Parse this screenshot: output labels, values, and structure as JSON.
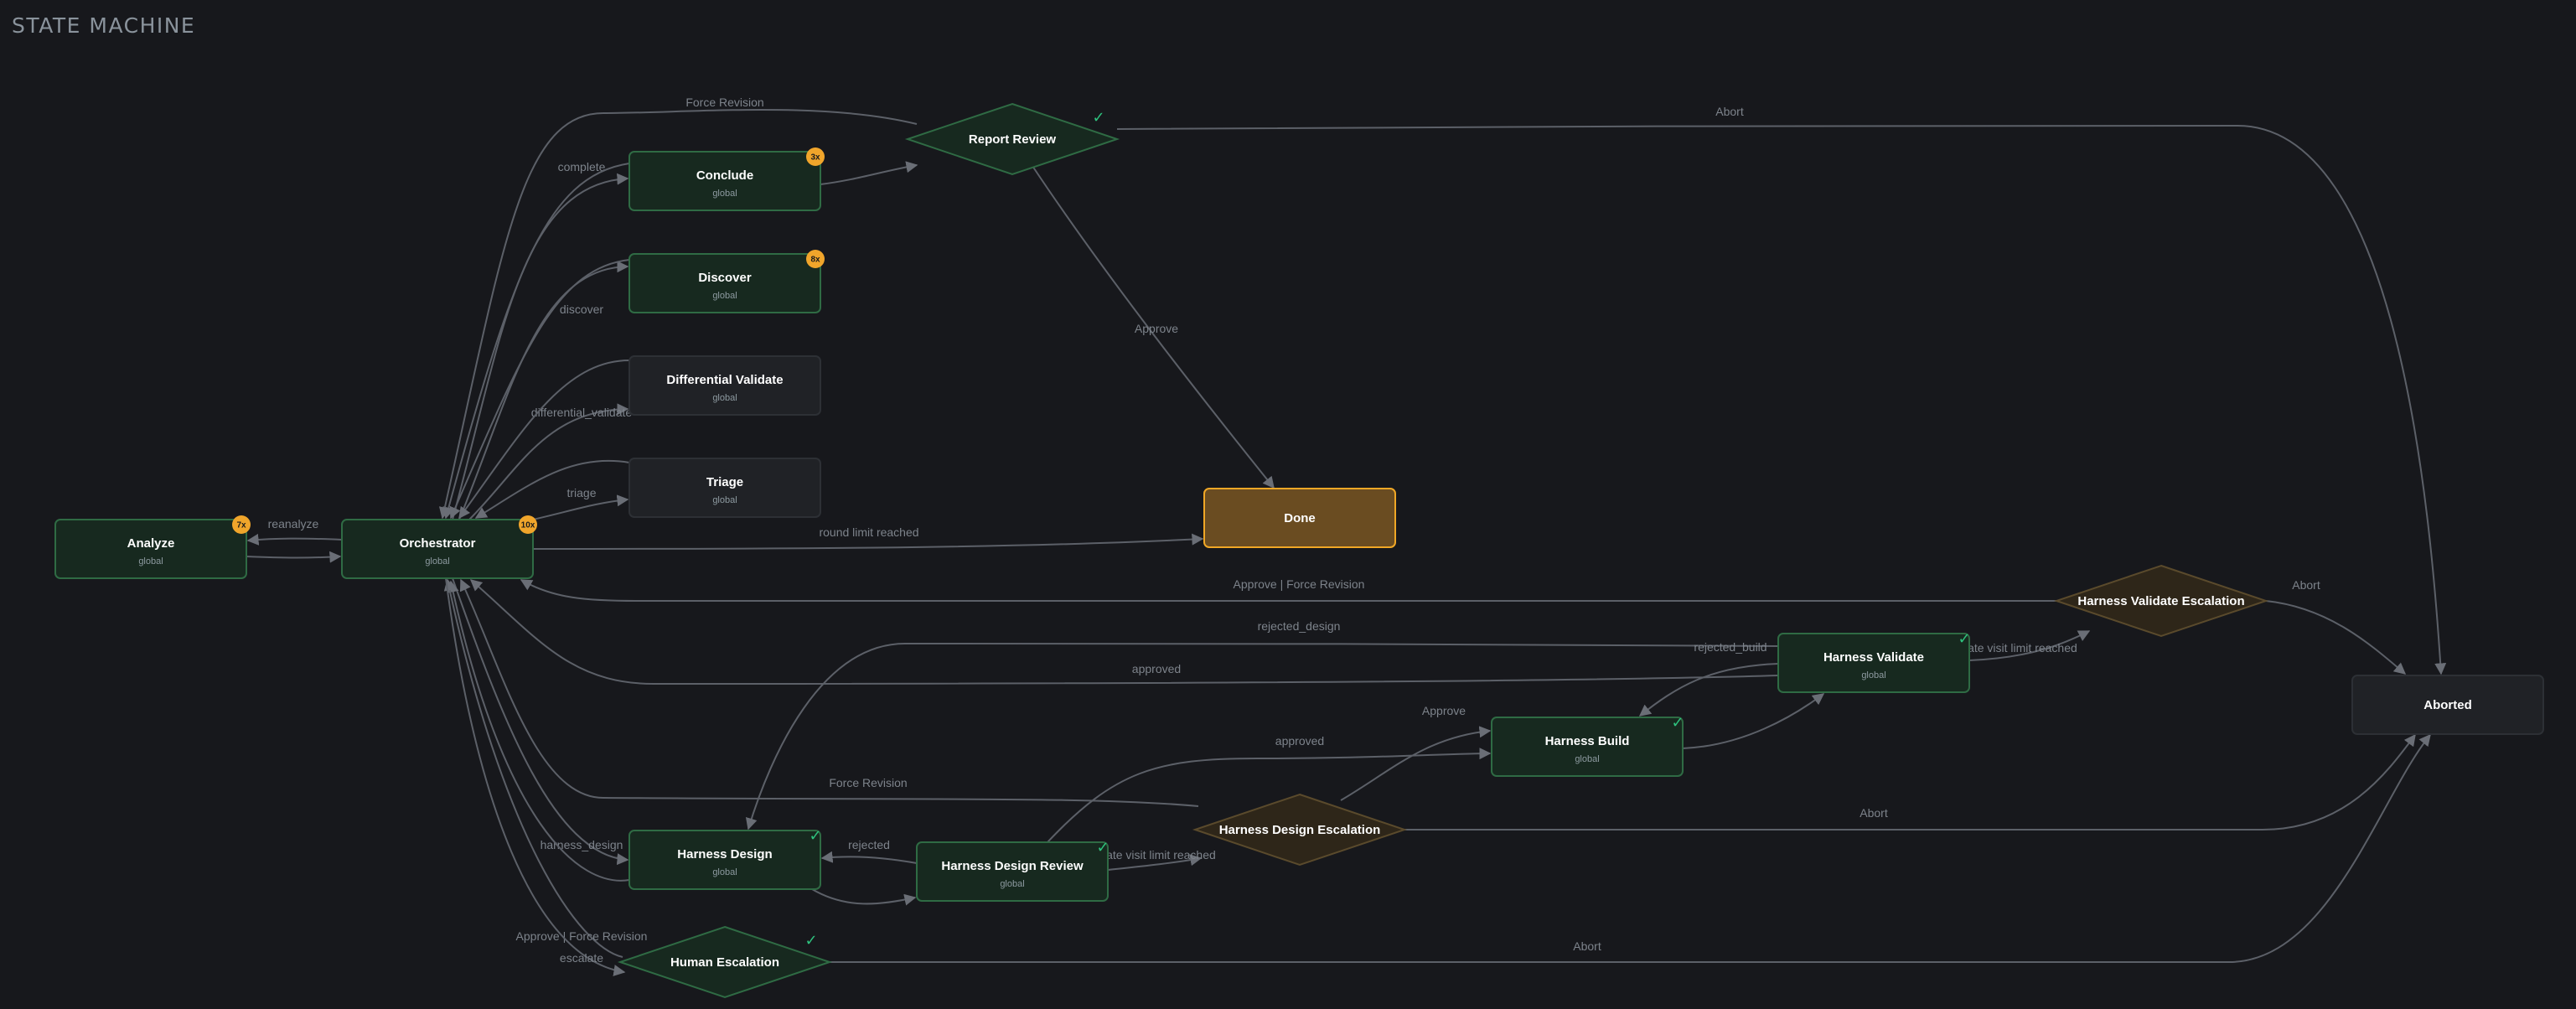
{
  "page": {
    "title": "STATE MACHINE"
  },
  "colors": {
    "background": "#17181c",
    "edge": "#5c6068",
    "edge_label": "#7d838b",
    "active_fill": "#17291f",
    "active_stroke": "#2f6b44",
    "idle_fill": "#202226",
    "idle_stroke": "#2d3035",
    "escalation_fill": "#2e2619",
    "escalation_stroke": "#5a4a2c",
    "done_fill": "#6a4c21",
    "done_stroke": "#f0a726",
    "badge": "#f0a52b",
    "check": "#2ec27e"
  },
  "nodes": [
    {
      "id": "analyze",
      "label": "Analyze",
      "sub": "global",
      "kind": "active",
      "badge": "7x"
    },
    {
      "id": "orchestrator",
      "label": "Orchestrator",
      "sub": "global",
      "kind": "active",
      "badge": "10x"
    },
    {
      "id": "conclude",
      "label": "Conclude",
      "sub": "global",
      "kind": "active",
      "badge": "3x"
    },
    {
      "id": "discover",
      "label": "Discover",
      "sub": "global",
      "kind": "active",
      "badge": "8x"
    },
    {
      "id": "differential-validate",
      "label": "Differential Validate",
      "sub": "global",
      "kind": "idle"
    },
    {
      "id": "triage",
      "label": "Triage",
      "sub": "global",
      "kind": "idle"
    },
    {
      "id": "report-review",
      "label": "Report Review",
      "kind": "decision-active",
      "check": true
    },
    {
      "id": "done",
      "label": "Done",
      "kind": "done"
    },
    {
      "id": "harness-validate-escalation",
      "label": "Harness Validate Escalation",
      "kind": "decision-escalation"
    },
    {
      "id": "harness-validate",
      "label": "Harness Validate",
      "sub": "global",
      "kind": "active",
      "check": true
    },
    {
      "id": "harness-build",
      "label": "Harness Build",
      "sub": "global",
      "kind": "active",
      "check": true
    },
    {
      "id": "aborted",
      "label": "Aborted",
      "kind": "idle"
    },
    {
      "id": "harness-design-escalation",
      "label": "Harness Design Escalation",
      "kind": "decision-escalation"
    },
    {
      "id": "harness-design",
      "label": "Harness Design",
      "sub": "global",
      "kind": "active",
      "check": true
    },
    {
      "id": "harness-design-review",
      "label": "Harness Design Review",
      "sub": "global",
      "kind": "active",
      "check": true
    },
    {
      "id": "human-escalation",
      "label": "Human Escalation",
      "kind": "decision-active",
      "check": true
    }
  ],
  "edges": [
    {
      "id": "analyze-to-orchestrator",
      "label": ""
    },
    {
      "id": "orchestrator-to-analyze",
      "label": "reanalyze"
    },
    {
      "id": "orchestrator-to-conclude",
      "label": "complete"
    },
    {
      "id": "orchestrator-to-discover",
      "label": "discover"
    },
    {
      "id": "orchestrator-to-differential-validate",
      "label": "differential_validate"
    },
    {
      "id": "orchestrator-to-triage",
      "label": "triage"
    },
    {
      "id": "conclude-to-orchestrator",
      "label": ""
    },
    {
      "id": "discover-to-orchestrator",
      "label": ""
    },
    {
      "id": "differential-validate-to-orchestrator",
      "label": ""
    },
    {
      "id": "triage-to-orchestrator",
      "label": ""
    },
    {
      "id": "conclude-to-report-review",
      "label": ""
    },
    {
      "id": "report-review-to-orchestrator",
      "label": "Force Revision"
    },
    {
      "id": "report-review-to-aborted",
      "label": "Abort"
    },
    {
      "id": "report-review-to-done",
      "label": "Approve"
    },
    {
      "id": "orchestrator-to-done",
      "label": "round limit reached"
    },
    {
      "id": "harness-validate-escalation-to-orchestrator",
      "label": "Approve | Force Revision"
    },
    {
      "id": "harness-validate-escalation-to-aborted",
      "label": "Abort"
    },
    {
      "id": "harness-validate-to-harness-design",
      "label": "rejected_design"
    },
    {
      "id": "harness-validate-to-orchestrator",
      "label": "approved"
    },
    {
      "id": "harness-validate-to-harness-build",
      "label": "rejected_build"
    },
    {
      "id": "harness-validate-to-harness-validate-escalation",
      "label": "state visit limit reached"
    },
    {
      "id": "harness-build-to-harness-validate",
      "label": ""
    },
    {
      "id": "harness-design-escalation-to-harness-build",
      "label": "Approve"
    },
    {
      "id": "harness-design-review-to-harness-build",
      "label": "approved"
    },
    {
      "id": "harness-design-escalation-to-orchestrator",
      "label": "Force Revision"
    },
    {
      "id": "harness-design-escalation-to-aborted",
      "label": "Abort"
    },
    {
      "id": "orchestrator-to-harness-design",
      "label": "harness_design"
    },
    {
      "id": "harness-design-to-orchestrator",
      "label": ""
    },
    {
      "id": "harness-design-review-to-harness-design",
      "label": "rejected"
    },
    {
      "id": "harness-design-to-harness-design-review",
      "label": ""
    },
    {
      "id": "harness-design-review-to-harness-design-escalation",
      "label": "state visit limit reached"
    },
    {
      "id": "human-escalation-to-orchestrator",
      "label": "Approve | Force Revision"
    },
    {
      "id": "orchestrator-to-human-escalation",
      "label": "escalate"
    },
    {
      "id": "human-escalation-to-aborted",
      "label": "Abort"
    }
  ]
}
